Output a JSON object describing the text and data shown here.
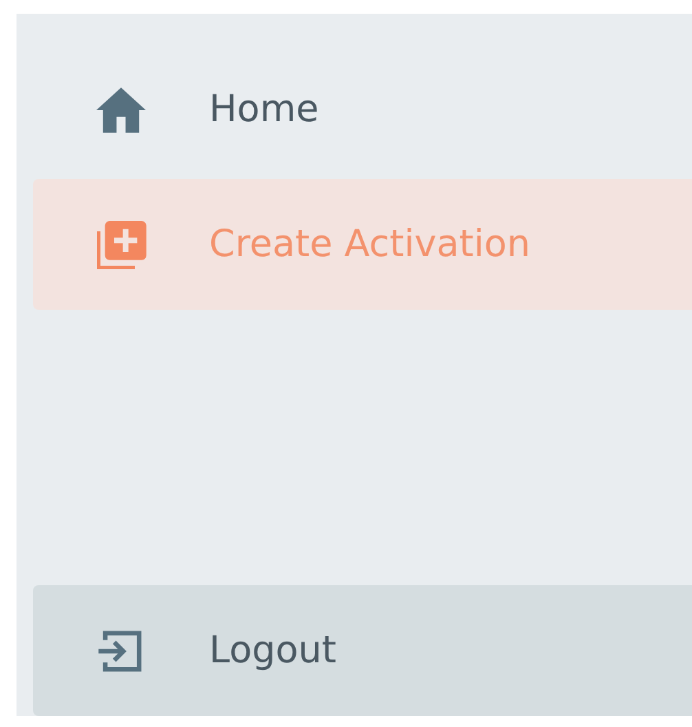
{
  "nav": {
    "items": [
      {
        "kind": "home",
        "label": "Home",
        "selected": false
      },
      {
        "kind": "create",
        "label": "Create Activation",
        "selected": true
      }
    ]
  },
  "footer": {
    "kind": "logout",
    "label": "Logout"
  }
}
